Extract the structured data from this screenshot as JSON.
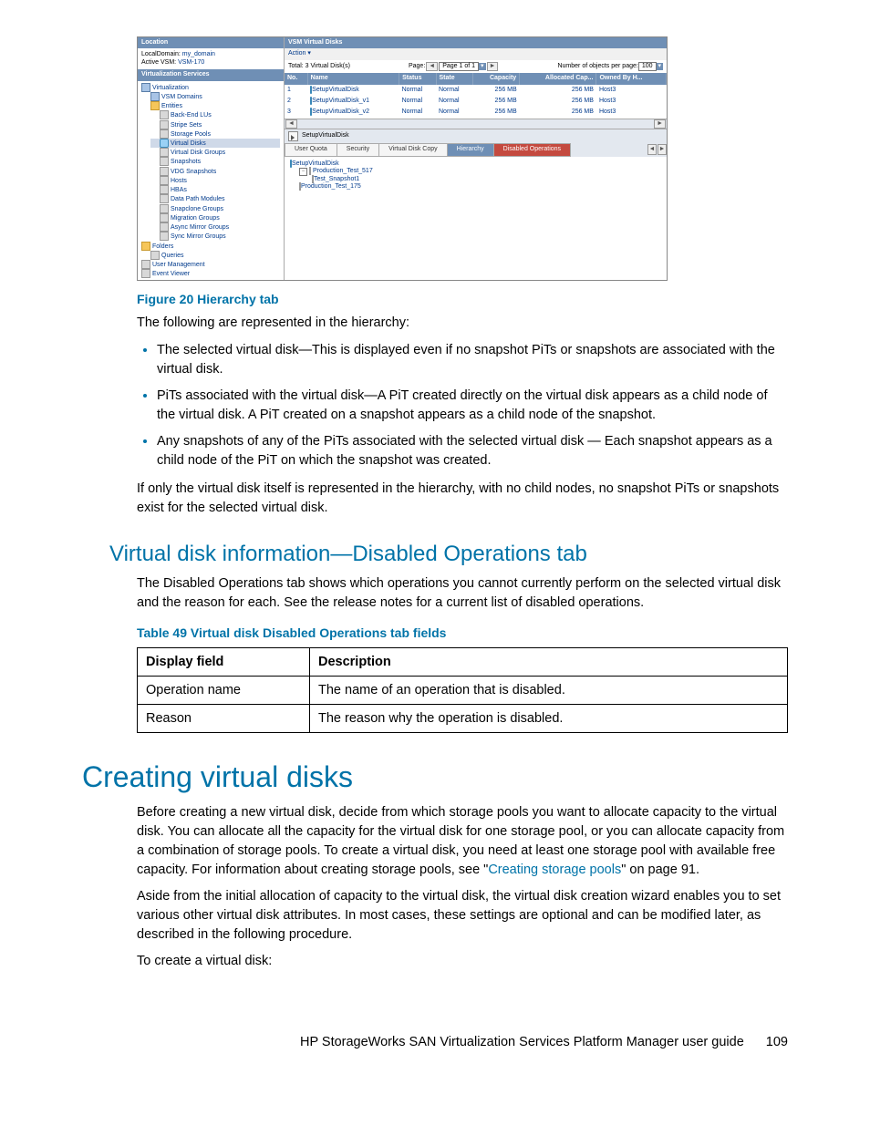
{
  "screenshot": {
    "location_header": "Location",
    "local_domain_label": "LocalDomain:",
    "local_domain_value": "my_domain",
    "active_vsm_label": "Active VSM:",
    "active_vsm_value": "VSM-170",
    "services_header": "Virtualization Services",
    "tree": {
      "root": "Virtualization",
      "vsm_domains": "VSM Domains",
      "entities": "Entities",
      "items": [
        "Back-End LUs",
        "Stripe Sets",
        "Storage Pools",
        "Virtual Disks",
        "Virtual Disk Groups",
        "Snapshots",
        "VDG Snapshots",
        "Hosts",
        "HBAs",
        "Data Path Modules",
        "Snapclone Groups",
        "Migration Groups",
        "Async Mirror Groups",
        "Sync Mirror Groups"
      ],
      "folders": "Folders",
      "queries": "Queries",
      "user_mgmt": "User Management",
      "event_viewer": "Event Viewer"
    },
    "right": {
      "title": "VSM Virtual Disks",
      "action": "Action ▾",
      "total": "Total: 3 Virtual Disk(s)",
      "page_label": "Page:",
      "page_value": "Page 1 of 1",
      "objects_label": "Number of objects per page:",
      "objects_value": "100",
      "columns": [
        "No.",
        "Name",
        "Status",
        "State",
        "Capacity",
        "Allocated Cap...",
        "Owned By H..."
      ],
      "rows": [
        {
          "no": "1",
          "name": "SetupVirtualDisk",
          "status": "Normal",
          "state": "Normal",
          "cap": "256  MB",
          "alloc": "256  MB",
          "host": "Host3"
        },
        {
          "no": "2",
          "name": "SetupVirtualDisk_v1",
          "status": "Normal",
          "state": "Normal",
          "cap": "256  MB",
          "alloc": "256  MB",
          "host": "Host3"
        },
        {
          "no": "3",
          "name": "SetupVirtualDisk_v2",
          "status": "Normal",
          "state": "Normal",
          "cap": "256  MB",
          "alloc": "256  MB",
          "host": "Host3"
        }
      ],
      "detail_name": "SetupVirtualDisk",
      "tabs": [
        "User Quota",
        "Security",
        "Virtual Disk Copy",
        "Hierarchy",
        "Disabled Operations"
      ],
      "hierarchy": [
        "SetupVirtualDisk",
        "Production_Test_517",
        "Test_Snapshot1",
        "Production_Test_175"
      ]
    }
  },
  "doc": {
    "fig_caption": "Figure 20 Hierarchy tab",
    "p1": "The following are represented in the hierarchy:",
    "bullets": [
      "The selected virtual disk—This is displayed even if no snapshot PiTs or snapshots are associated with the virtual disk.",
      "PiTs associated with the virtual disk—A PiT created directly on the virtual disk appears as a child node of the virtual disk. A PiT created on a snapshot appears as a child node of the snapshot.",
      "Any snapshots of any of the PiTs associated with the selected virtual disk — Each snapshot appears as a child node of the PiT on which the snapshot was created."
    ],
    "p2": "If only the virtual disk itself is represented in the hierarchy, with no child nodes, no snapshot PiTs or snapshots exist for the selected virtual disk.",
    "h2": "Virtual disk information—Disabled Operations tab",
    "p3": "The Disabled Operations tab shows which operations you cannot currently perform on the selected virtual disk and the reason for each. See the release notes for a current list of disabled operations.",
    "table_caption": "Table 49 Virtual disk Disabled Operations tab fields",
    "table": {
      "h1": "Display field",
      "h2": "Description",
      "rows": [
        [
          "Operation name",
          "The name of an operation that is disabled."
        ],
        [
          "Reason",
          "The reason why the operation is disabled."
        ]
      ]
    },
    "h1": "Creating virtual disks",
    "p4a": "Before creating a new virtual disk, decide from which storage pools you want to allocate capacity to the virtual disk. You can allocate all the capacity for the virtual disk for one storage pool, or you can allocate capacity from a combination of storage pools. To create a virtual disk, you need at least one storage pool with available free capacity. For information about creating storage pools, see \"",
    "link": "Creating storage pools",
    "p4b": "\" on page 91.",
    "p5": "Aside from the initial allocation of capacity to the virtual disk, the virtual disk creation wizard enables you to set various other virtual disk attributes. In most cases, these settings are optional and can be modified later, as described in the following procedure.",
    "p6": "To create a virtual disk:",
    "footer_text": "HP StorageWorks SAN Virtualization Services Platform Manager user guide",
    "footer_page": "109"
  }
}
